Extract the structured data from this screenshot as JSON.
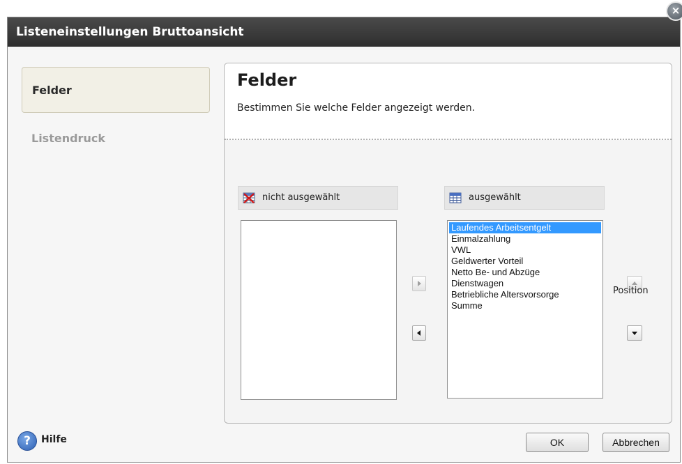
{
  "dialog": {
    "title": "Listeneinstellungen Bruttoansicht",
    "close_icon": "close-icon"
  },
  "nav": {
    "items": [
      {
        "label": "Felder",
        "active": true
      },
      {
        "label": "Listendruck",
        "active": false
      }
    ]
  },
  "panel": {
    "title": "Felder",
    "subtitle": "Bestimmen Sie welche Felder angezeigt werden."
  },
  "available_list": {
    "header": "nicht ausgewählt",
    "icon": "table-remove-icon",
    "items": []
  },
  "selected_list": {
    "header": "ausgewählt",
    "icon": "table-icon",
    "items": [
      "Laufendes Arbeitsentgelt",
      "Einmalzahlung",
      "VWL",
      "Geldwerter Vorteil",
      "Netto Be- und Abzüge",
      "Dienstwagen",
      "Betriebliche Altersvorsorge",
      "Summe"
    ],
    "selected_index": 0
  },
  "transfer": {
    "add_icon": "arrow-right-icon",
    "remove_icon": "arrow-left-icon"
  },
  "position": {
    "label": "Position",
    "up_icon": "arrow-up-icon",
    "down_icon": "arrow-down-icon"
  },
  "footer": {
    "help_label": "Hilfe",
    "help_icon": "help-icon",
    "ok_label": "OK",
    "cancel_label": "Abbrechen"
  },
  "colors": {
    "titlebar": "#3a3a3a",
    "selection": "#3399ff"
  }
}
